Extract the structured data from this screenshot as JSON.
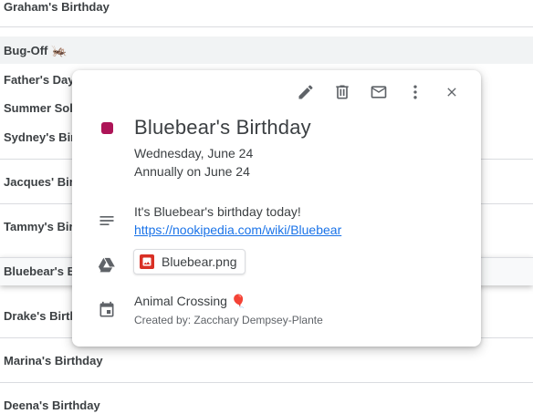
{
  "background_events": [
    {
      "label": "Graham's Birthday",
      "emoji": ""
    },
    {
      "label": "Bug-Off",
      "emoji": "🦗"
    },
    {
      "label": "Father's Day",
      "emoji": ""
    },
    {
      "label": "Summer Sol",
      "emoji": ""
    },
    {
      "label": "Sydney's Bir",
      "emoji": ""
    },
    {
      "label": "Jacques' Bir",
      "emoji": ""
    },
    {
      "label": "Tammy's Bir",
      "emoji": ""
    },
    {
      "label": "Bluebear's B",
      "emoji": ""
    },
    {
      "label": "Drake's Birth",
      "emoji": ""
    },
    {
      "label": "Marina's Birthday",
      "emoji": ""
    },
    {
      "label": "Deena's Birthday",
      "emoji": ""
    }
  ],
  "event": {
    "title": "Bluebear's Birthday",
    "date": "Wednesday, June 24",
    "recurrence": "Annually on June 24",
    "description": "It's Bluebear's birthday today!",
    "link": "https://nookipedia.com/wiki/Bluebear",
    "attachment": "Bluebear.png",
    "calendar": "Animal Crossing 🎈",
    "created_by": "Created by: Zacchary Dempsey-Plante",
    "color": "#ad1457"
  },
  "toolbar": {
    "edit_icon": "pencil-icon",
    "delete_icon": "trash-icon",
    "email_icon": "mail-icon",
    "more_icon": "more-vert-icon",
    "close_icon": "close-icon"
  },
  "colors": {
    "accent_link": "#1a73e8",
    "attachment_red": "#d93025",
    "icon_gray": "#5f6368"
  }
}
